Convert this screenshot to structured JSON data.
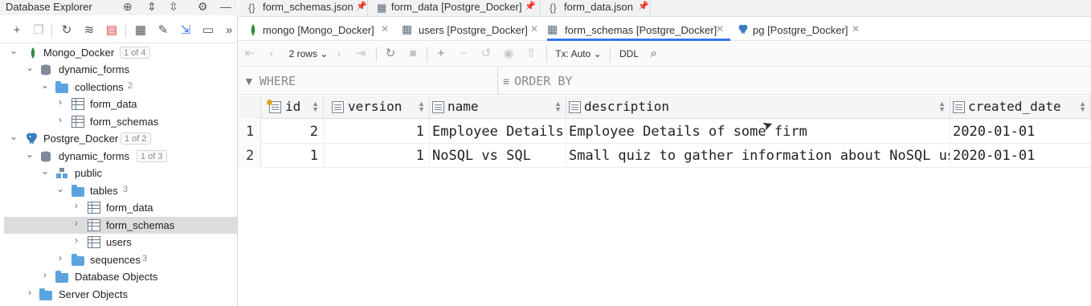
{
  "left_panel": {
    "title": "Database Explorer",
    "tree": [
      {
        "label": "Mongo_Docker",
        "badge": "1 of 4"
      },
      {
        "label": "dynamic_forms"
      },
      {
        "label": "collections",
        "count": "2"
      },
      {
        "label": "form_data"
      },
      {
        "label": "form_schemas"
      },
      {
        "label": "Postgre_Docker",
        "badge": "1 of 2"
      },
      {
        "label": "dynamic_forms",
        "badge": "1 of 3"
      },
      {
        "label": "public"
      },
      {
        "label": "tables",
        "count": "3"
      },
      {
        "label": "form_data"
      },
      {
        "label": "form_schemas"
      },
      {
        "label": "users"
      },
      {
        "label": "sequences",
        "count": "3"
      },
      {
        "label": "Database Objects"
      },
      {
        "label": "Server Objects"
      }
    ]
  },
  "file_tabs": [
    {
      "label": "form_schemas.json"
    },
    {
      "label": "form_data [Postgre_Docker]"
    },
    {
      "label": "form_data.json"
    }
  ],
  "editor_tabs": [
    {
      "label": "mongo [Mongo_Docker]"
    },
    {
      "label": "users [Postgre_Docker]"
    },
    {
      "label": "form_schemas [Postgre_Docker]",
      "active": true
    },
    {
      "label": "pg [Postgre_Docker]"
    }
  ],
  "grid_toolbar": {
    "rows_label": "2 rows",
    "tx_label": "Tx: Auto",
    "ddl_label": "DDL"
  },
  "filters": {
    "where": "WHERE",
    "order_by": "ORDER BY"
  },
  "table": {
    "columns": [
      "id",
      "version",
      "name",
      "description",
      "created_date"
    ],
    "rows": [
      {
        "num": "1",
        "id": "2",
        "version": "1",
        "name": "Employee Details",
        "description": "Employee Details of some firm",
        "created_date": "2020-01-01"
      },
      {
        "num": "2",
        "id": "1",
        "version": "1",
        "name": "NoSQL vs SQL",
        "description": "Small quiz to gather information about NoSQL us",
        "created_date": "2020-01-01"
      }
    ]
  },
  "colors": {
    "accent": "#3574f0",
    "selected_row": "#dcdcdc",
    "mongo_green": "#2e8b3e",
    "postgres_blue": "#3d7bc0"
  }
}
